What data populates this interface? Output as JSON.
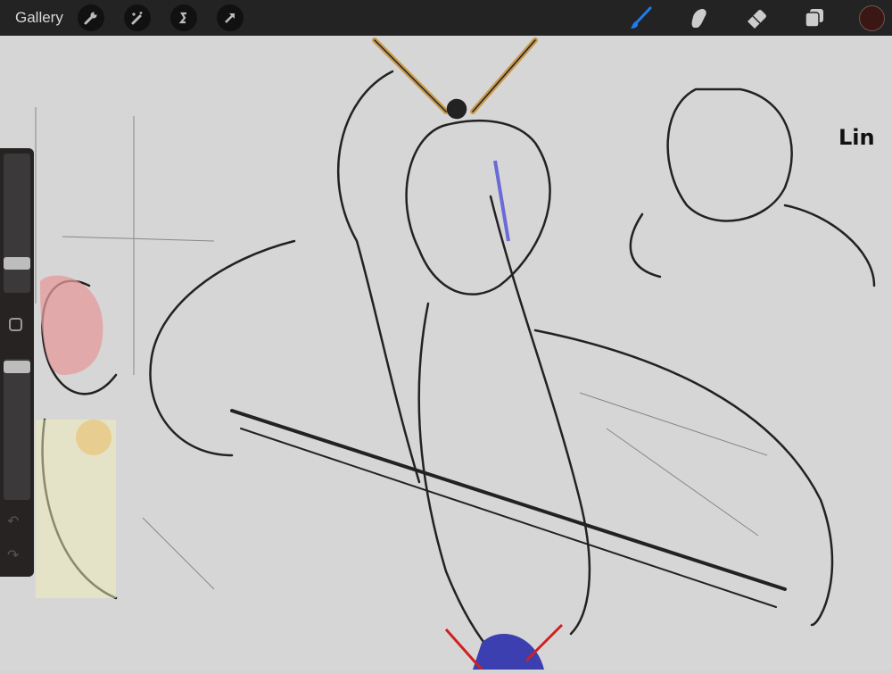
{
  "toolbar": {
    "gallery_label": "Gallery",
    "left_tools": [
      "wrench-icon",
      "magic-wand-icon",
      "selection-icon",
      "move-arrow-icon"
    ],
    "right_tools": [
      "brush-icon",
      "smudge-icon",
      "eraser-icon",
      "layers-icon"
    ],
    "active_tool": "brush",
    "active_tool_color": "#1e7cf0",
    "current_color": "#3a1712"
  },
  "sidebar": {
    "brush_size_fraction": 0.24,
    "opacity_fraction": 0.97,
    "modify_button": "square-icon",
    "undo_icon": "undo-icon",
    "redo_icon": "redo-icon"
  },
  "canvas": {
    "sketch_text": "Lin"
  }
}
